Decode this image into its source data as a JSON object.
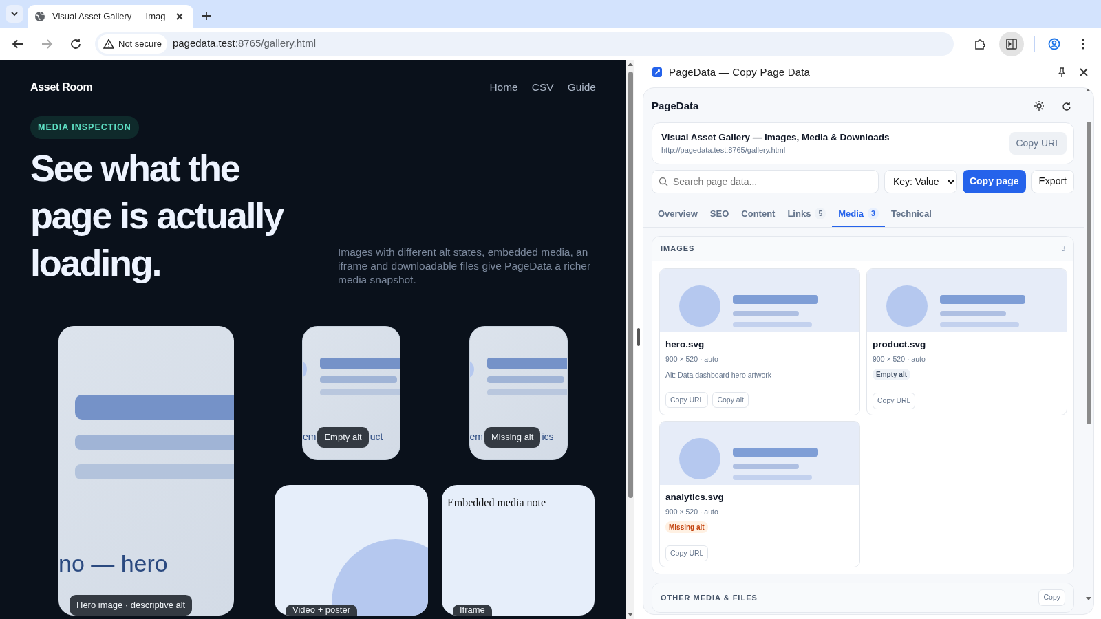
{
  "browser": {
    "tabs": [
      {
        "title": "Visual Asset Gallery — Imag",
        "selected": true
      }
    ],
    "address": {
      "security": "Not secure",
      "host": "pagedata.test",
      "path": ":8765/gallery.html"
    },
    "side_panel_on": true
  },
  "page": {
    "brand": "Asset Room",
    "nav": [
      "Home",
      "CSV",
      "Guide"
    ],
    "eyebrow": "MEDIA INSPECTION",
    "headline": "See what the page is actually loading.",
    "intro": "Images with different alt states, embedded media, an iframe and downloadable files give PageData a richer media snapshot.",
    "tiles": [
      {
        "kind": "hero",
        "fallback": "no — hero",
        "chip": "Hero image · descriptive alt"
      },
      {
        "kind": "thumb",
        "fallback_before": "em",
        "fallback_after": "uct",
        "chip": "Empty alt"
      },
      {
        "kind": "thumb",
        "fallback_before": "em",
        "fallback_after": "ics",
        "chip": "Missing alt"
      },
      {
        "kind": "video",
        "chip": "Video + poster"
      },
      {
        "kind": "iframe",
        "note": "Embedded media note",
        "chip": "Iframe"
      }
    ]
  },
  "panel": {
    "title": "PageData — Copy Page Data",
    "app_name": "PageData",
    "page": {
      "title": "Visual Asset Gallery — Images, Media & Downloads",
      "url": "http://pagedata.test:8765/gallery.html",
      "action": "Copy URL"
    },
    "search": {
      "placeholder": "Search page data..."
    },
    "format": "Key: Value",
    "copy_page": "Copy page",
    "export": "Export",
    "tabs": [
      {
        "label": "Overview",
        "selected": false
      },
      {
        "label": "SEO",
        "selected": false
      },
      {
        "label": "Content",
        "selected": false
      },
      {
        "label": "Links",
        "count": "5",
        "selected": false
      },
      {
        "label": "Media",
        "count": "3",
        "selected": true
      },
      {
        "label": "Technical",
        "selected": false
      }
    ],
    "images": {
      "heading": "IMAGES",
      "count": "3",
      "items": [
        {
          "name": "hero.svg",
          "dims": "900 × 520 · auto",
          "alt": "Alt: Data dashboard hero artwork",
          "actions": [
            "Copy URL",
            "Copy alt"
          ]
        },
        {
          "name": "product.svg",
          "dims": "900 × 520 · auto",
          "status": {
            "label": "Empty alt",
            "kind": "empty"
          },
          "actions": [
            "Copy URL"
          ]
        },
        {
          "name": "analytics.svg",
          "dims": "900 × 520 · auto",
          "status": {
            "label": "Missing alt",
            "kind": "missing"
          },
          "actions": [
            "Copy URL"
          ]
        }
      ]
    },
    "other": {
      "heading": "OTHER MEDIA & FILES",
      "action": "Copy"
    }
  }
}
